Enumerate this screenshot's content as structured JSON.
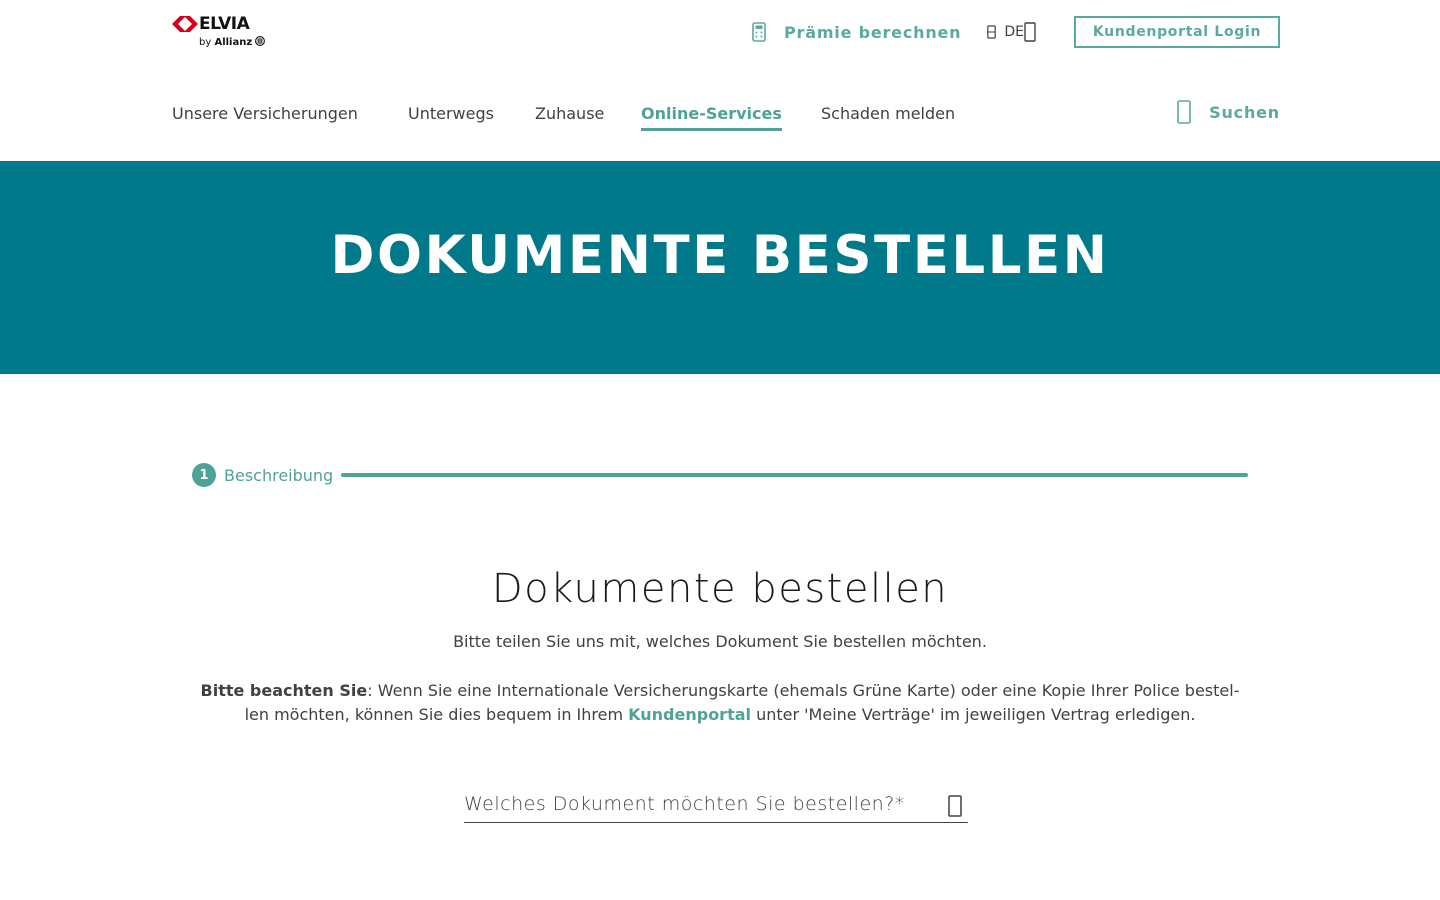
{
  "header": {
    "brand": "ELVIA",
    "by": "by",
    "partner": "Allianz",
    "premium_label": "Prämie berechnen",
    "language": "DE",
    "login_label": "Kundenportal Login",
    "search_label": "Suchen",
    "accent_color": "#5aaa9f"
  },
  "nav": {
    "items": [
      {
        "label": "Unsere Versicherungen"
      },
      {
        "label": "Unterwegs"
      },
      {
        "label": "Zuhause"
      },
      {
        "label": "Online-Services",
        "active": true
      },
      {
        "label": "Schaden melden"
      }
    ]
  },
  "hero": {
    "title": "DOKUMENTE BESTELLEN",
    "background": "#007a8a"
  },
  "stepper": {
    "step_number": "1",
    "step_label": "Beschreibung"
  },
  "content": {
    "title": "Dokumente bestellen",
    "intro": "Bitte teilen Sie uns mit, welches Dokument Sie bestellen möchten.",
    "notice_bold": "Bitte beachten Sie",
    "notice_part1": ": Wenn Sie eine Internationale Versicherungskarte (ehemals Grüne Karte) oder eine Kopie Ihrer Police bestel-len möchten, können Sie dies bequem in Ihrem ",
    "notice_link": "Kundenportal",
    "notice_part2": " unter 'Meine Verträge' im jeweiligen Vertrag erledigen.",
    "select_label": "Welches Dokument möchten Sie bestellen?*"
  }
}
